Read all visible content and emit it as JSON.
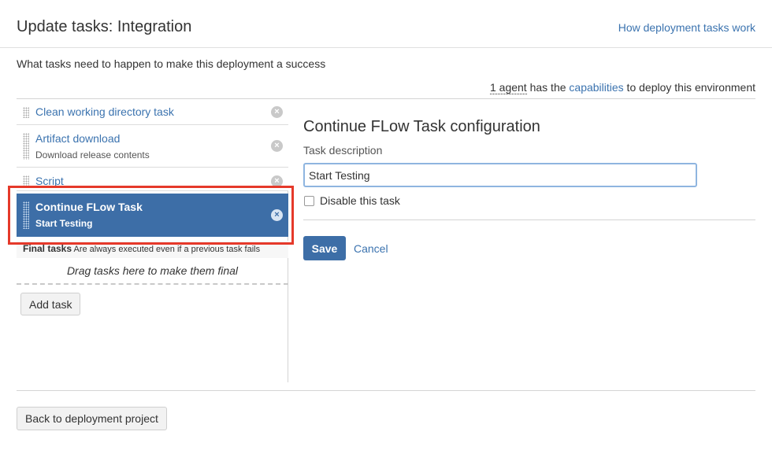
{
  "page": {
    "title": "Update tasks: Integration",
    "help_link": "How deployment tasks work",
    "intro": "What tasks need to happen to make this deployment a success",
    "agent_count": "1 agent",
    "agent_text_1": " has the ",
    "capabilities_link": "capabilities",
    "agent_text_2": " to deploy this environment"
  },
  "tasks": [
    {
      "name": "Clean working directory task",
      "subtitle": ""
    },
    {
      "name": "Artifact download",
      "subtitle": "Download release contents"
    },
    {
      "name": "Script",
      "subtitle": ""
    },
    {
      "name": "Continue FLow Task",
      "subtitle": "Start Testing",
      "selected": true
    }
  ],
  "remove_icon": "×",
  "final_tasks": {
    "title": "Final tasks",
    "description": "Are always executed even if a previous task fails",
    "drop_text": "Drag tasks here to make them final"
  },
  "add_task_label": "Add task",
  "config": {
    "title": "Continue FLow Task configuration",
    "description_label": "Task description",
    "description_value": "Start Testing",
    "disable_label": "Disable this task",
    "disable_checked": false,
    "save_label": "Save",
    "cancel_label": "Cancel"
  },
  "back_label": "Back to deployment project",
  "colors": {
    "accent": "#3d6ea7",
    "link": "#3b73af",
    "highlight": "#e5392a"
  }
}
